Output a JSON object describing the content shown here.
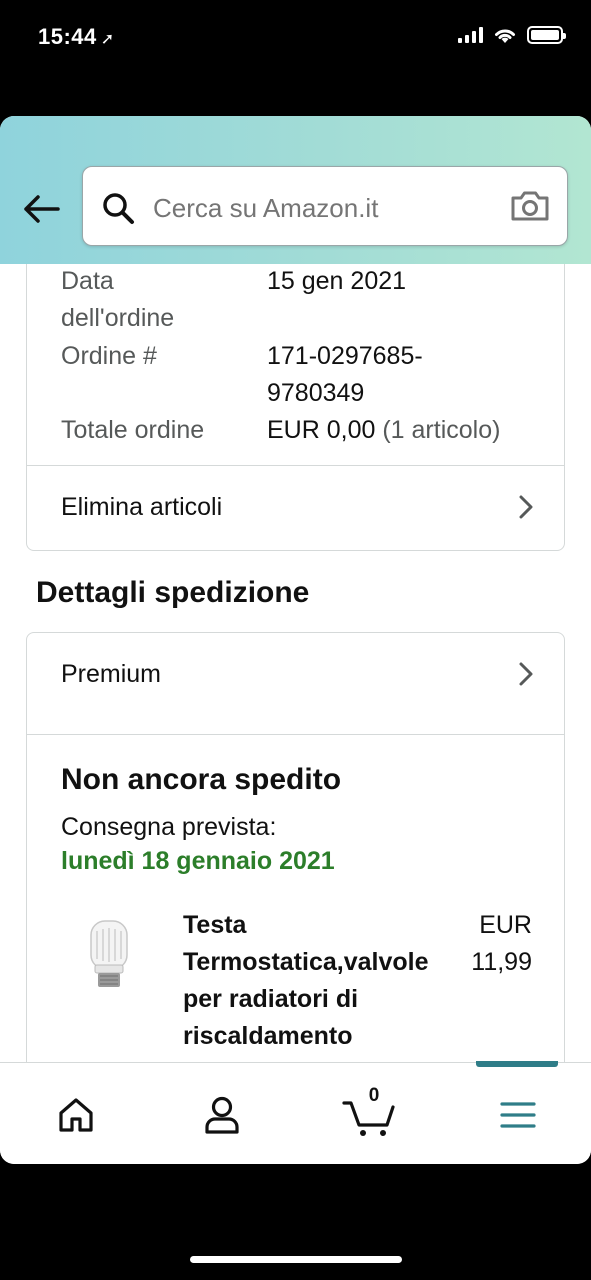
{
  "status_bar": {
    "time": "15:44"
  },
  "search": {
    "placeholder": "Cerca su Amazon.it"
  },
  "order": {
    "date_label": "Data\ndell'ordine",
    "date_value": "15 gen 2021",
    "number_label": "Ordine #",
    "number_value": "171-0297685-\n9780349",
    "total_label": "Totale ordine",
    "total_value": "EUR 0,00",
    "total_count": "(1 articolo)",
    "delete_items_label": "Elimina articoli"
  },
  "shipping": {
    "section_title": "Dettagli spedizione",
    "premium_label": "Premium",
    "status": "Non ancora spedito",
    "delivery_label": "Consegna prevista:",
    "delivery_date": "lunedì 18 gennaio 2021",
    "item": {
      "title": "Testa Termostatica,valvole per radiatori di riscaldamento",
      "price": "EUR 11,99"
    }
  },
  "tabbar": {
    "cart_count": "0",
    "active_tab": "menu",
    "accent_color": "#2f7d88"
  },
  "colors": {
    "delivery_green": "#2c7e2a",
    "header_gradient_start": "#8fd3dc",
    "header_gradient_end": "#b2e6d2"
  }
}
